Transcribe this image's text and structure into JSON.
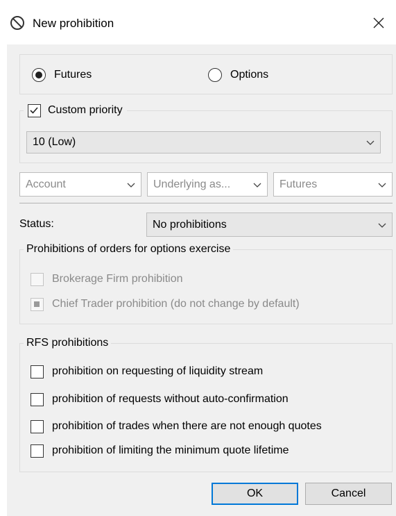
{
  "window": {
    "title": "New prohibition",
    "title_icon": "prohibition-icon",
    "close_icon": "close-icon"
  },
  "instrument_type": {
    "options": [
      "Futures",
      "Options"
    ],
    "selected": "Futures"
  },
  "priority": {
    "label": "Custom priority",
    "checked": true,
    "value": "10 (Low)"
  },
  "filters": {
    "account": "Account",
    "underlying": "Underlying as...",
    "instrument": "Futures"
  },
  "status": {
    "label": "Status:",
    "value": "No prohibitions"
  },
  "exercise_group": {
    "caption": "Prohibitions of orders for  options exercise",
    "items": [
      {
        "label": "Brokerage Firm prohibition",
        "state": "unchecked",
        "enabled": false
      },
      {
        "label": "Chief Trader prohibition (do not change by default)",
        "state": "indeterminate",
        "enabled": false
      }
    ]
  },
  "rfs_group": {
    "caption": "RFS prohibitions",
    "items": [
      {
        "label": "prohibition on requesting of liquidity stream",
        "checked": false
      },
      {
        "label": "prohibition of requests  without auto-confirmation",
        "checked": false
      },
      {
        "label": "prohibition of trades when there are not enough quotes",
        "checked": false
      },
      {
        "label": "prohibition of limiting the minimum quote lifetime",
        "checked": false
      }
    ]
  },
  "buttons": {
    "ok": "OK",
    "cancel": "Cancel"
  },
  "colors": {
    "accent": "#0078d7",
    "dialog_bg": "#f0f0f0",
    "disabled_text": "#8a8a8a"
  }
}
